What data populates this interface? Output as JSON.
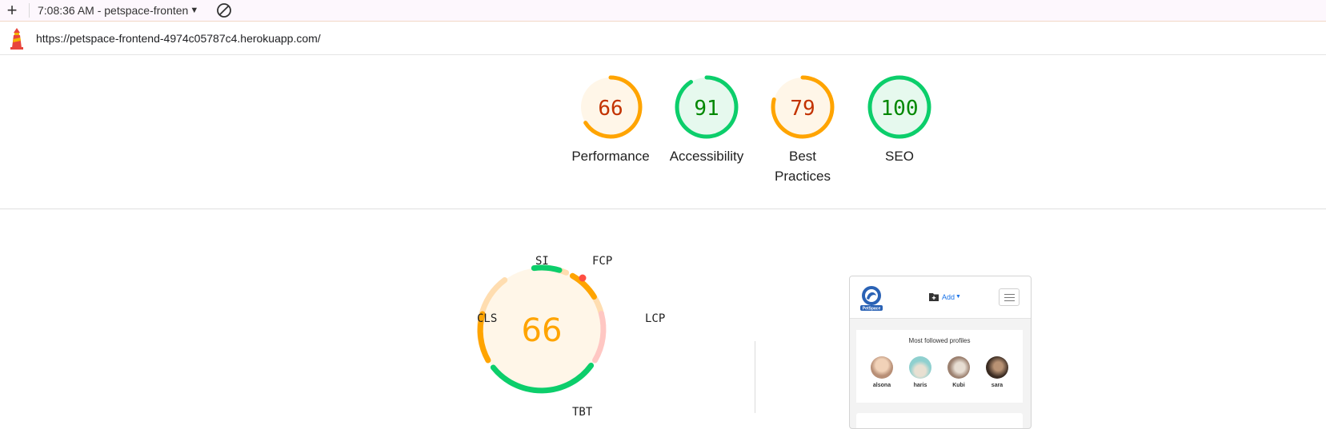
{
  "toolbar": {
    "add_icon": "plus-icon",
    "title": "7:08:36 AM - petspace-fronten",
    "dropdown_icon": "caret-down-icon",
    "clear_icon": "block-icon"
  },
  "url_bar": {
    "icon": "lighthouse-icon",
    "url": "https://petspace-frontend-4974c05787c4.herokuapp.com/"
  },
  "scores": [
    {
      "value": 66,
      "label": "Performance",
      "status": "average"
    },
    {
      "value": 91,
      "label": "Accessibility",
      "status": "pass"
    },
    {
      "value": 79,
      "label": "Best Practices",
      "status": "average"
    },
    {
      "value": 100,
      "label": "SEO",
      "status": "pass"
    }
  ],
  "colors": {
    "pass": "#0cce6b",
    "pass_text": "#008800",
    "pass_fill": "#e6f9ee",
    "average": "#ffa400",
    "average_text": "#c33300",
    "average_fill": "#fff6e8",
    "fail": "#ff4e42",
    "fail_light": "#ffc7c3",
    "average_light": "#ffddb0"
  },
  "performance_gauge": {
    "score": 66,
    "metrics": [
      {
        "abbr": "SI",
        "status": "pass"
      },
      {
        "abbr": "FCP",
        "status": "average"
      },
      {
        "abbr": "LCP",
        "status": "fail"
      },
      {
        "abbr": "TBT",
        "status": "pass"
      },
      {
        "abbr": "CLS",
        "status": "average"
      }
    ]
  },
  "screenshot": {
    "add_label": "Add",
    "logo_text": "PetSpace",
    "card_title": "Most followed profiles",
    "profiles": [
      {
        "name": "alsona",
        "color": "#b88f76"
      },
      {
        "name": "haris",
        "color": "#8fd0cf"
      },
      {
        "name": "Kubi",
        "color": "#9c8170"
      },
      {
        "name": "sara",
        "color": "#3a2b22"
      }
    ]
  }
}
